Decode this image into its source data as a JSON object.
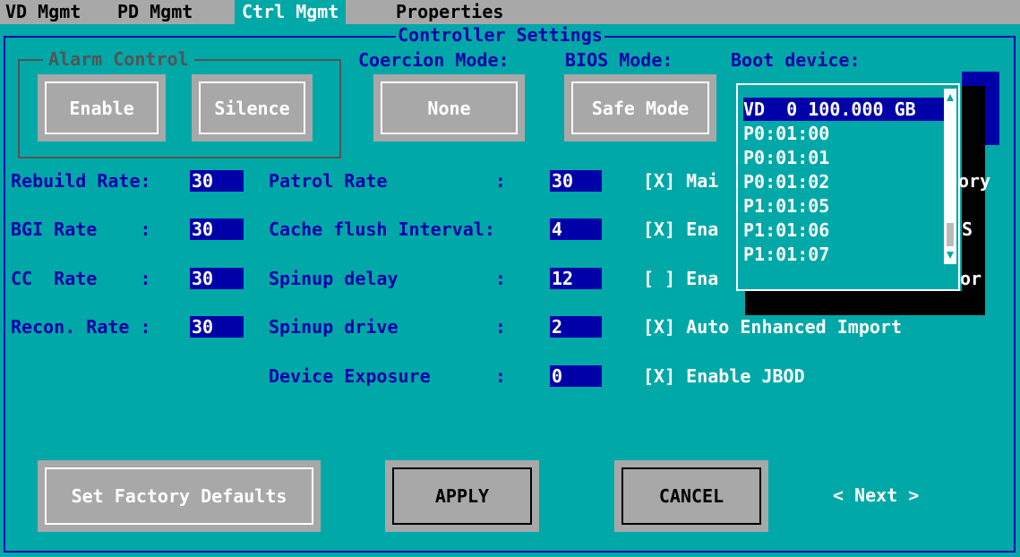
{
  "menu": {
    "items": [
      "VD Mgmt",
      "PD Mgmt",
      "Ctrl Mgmt",
      "Properties"
    ],
    "active": "Ctrl Mgmt"
  },
  "section_title": "Controller Settings",
  "alarm": {
    "title": "Alarm Control",
    "enable": "Enable",
    "silence": "Silence"
  },
  "coercion": {
    "label": "Coercion Mode:",
    "value": "None"
  },
  "bios": {
    "label": "BIOS Mode:",
    "value": "Safe Mode"
  },
  "boot": {
    "label": "Boot device:",
    "selected": "VD  0 100.000 GB",
    "options": [
      "VD  0 100.000 GB",
      "P0:01:00",
      "P0:01:01",
      "P0:01:02",
      "P1:01:05",
      "P1:01:06",
      "P1:01:07"
    ]
  },
  "rates": {
    "rebuild": {
      "label": "Rebuild Rate:",
      "value": "30"
    },
    "bgi": {
      "label": "BGI Rate    :",
      "value": "30"
    },
    "cc": {
      "label": "CC  Rate    :",
      "value": "30"
    },
    "recon": {
      "label": "Recon. Rate :",
      "value": "30"
    }
  },
  "settings": {
    "patrol": {
      "label": "Patrol Rate          :",
      "value": "30"
    },
    "cache": {
      "label": "Cache flush Interval:",
      "value": "4"
    },
    "spinup_delay": {
      "label": "Spinup delay         :",
      "value": "12"
    },
    "spinup_drive": {
      "label": "Spinup drive         :",
      "value": "2"
    },
    "device_exposure": {
      "label": "Device Exposure      :",
      "value": "0"
    }
  },
  "checkboxes": {
    "row1": {
      "text": "[X] Mai",
      "tail": "ory"
    },
    "row2": {
      "text": "[X] Ena",
      "tail": "S"
    },
    "row3": {
      "text": "[ ] Ena",
      "tail": "or"
    },
    "row4": {
      "text": "[X] Auto Enhanced Import"
    },
    "row5": {
      "text": "[X] Enable JBOD"
    }
  },
  "buttons": {
    "factory": "Set Factory Defaults",
    "apply": "APPLY",
    "cancel": "CANCEL",
    "next": "< Next >"
  },
  "colors": {
    "background": "#00A8A8",
    "label_blue": "#0000A8",
    "menubar": "#A8A8A8",
    "button_gray": "#A8A8A8",
    "shadow": "#000000"
  }
}
